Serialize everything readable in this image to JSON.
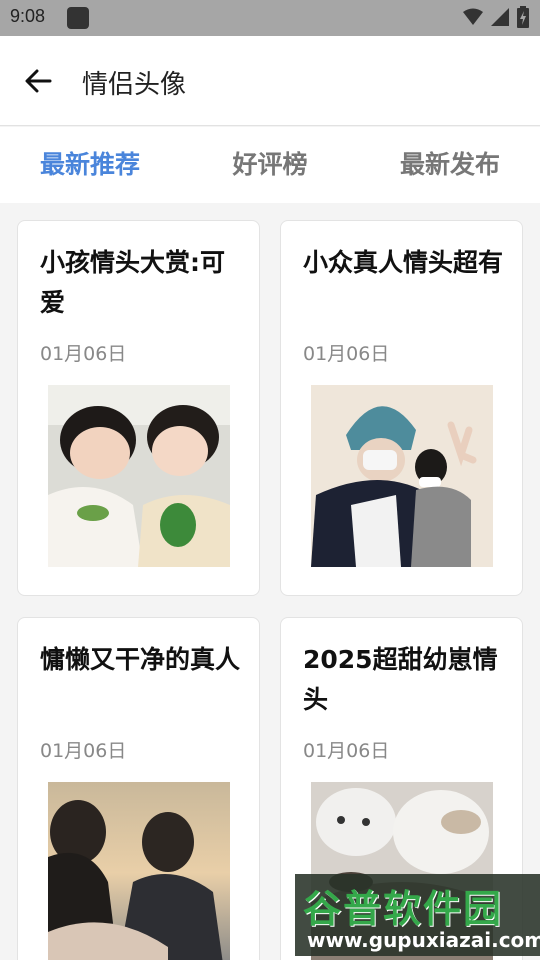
{
  "status_bar": {
    "time": "9:08"
  },
  "header": {
    "title": "情侣头像"
  },
  "tabs": [
    {
      "label": "最新推荐",
      "active": true
    },
    {
      "label": "好评榜",
      "active": false
    },
    {
      "label": "最新发布",
      "active": false
    }
  ],
  "cards": [
    {
      "title": "小孩情头大赏:可爱",
      "date": "01月06日"
    },
    {
      "title": "小众真人情头超有",
      "date": "01月06日"
    },
    {
      "title": "慵懒又干净的真人",
      "date": "01月06日"
    },
    {
      "title": "2025超甜幼崽情头",
      "date": "01月06日"
    }
  ],
  "watermark": {
    "title": "谷普软件园",
    "url": "www.gupuxiazai.com"
  },
  "colors": {
    "accent": "#4a85db",
    "status_bar": "#a6a6a6"
  }
}
